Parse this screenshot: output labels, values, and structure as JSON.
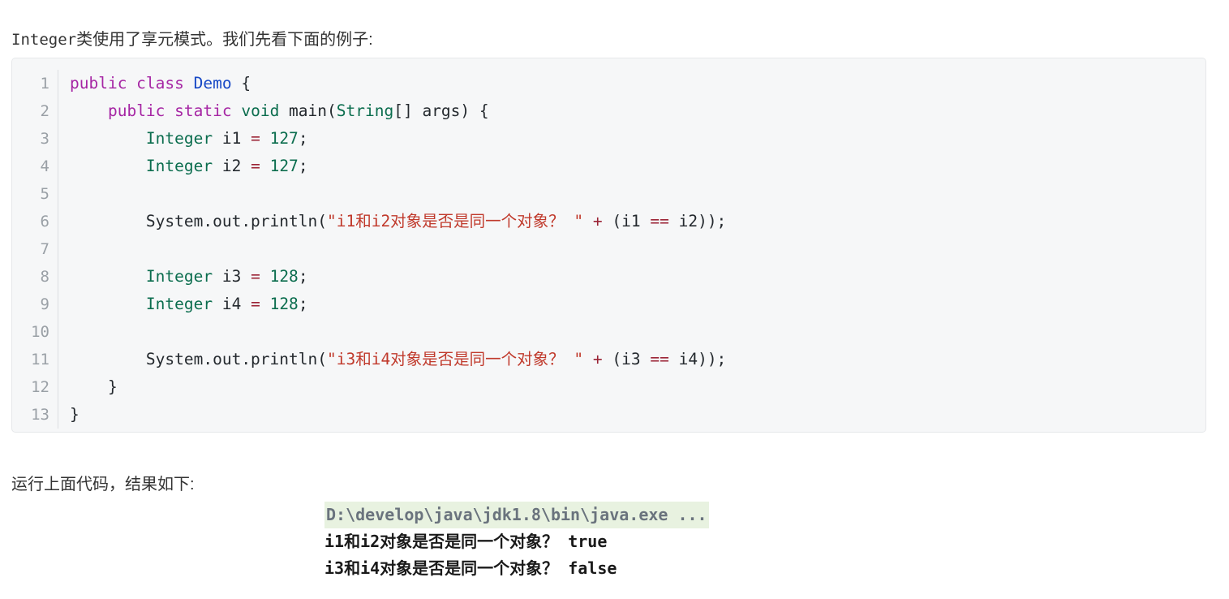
{
  "intro": {
    "mono_prefix": "Integer",
    "text": "类使用了享元模式。我们先看下面的例子:"
  },
  "code_block": {
    "language": "java",
    "theme": {
      "background": "#f6f7f8",
      "border": "#e6e8ea",
      "line_number": "#9aa0a6",
      "keyword": "#a626a4",
      "type": "#0b6d4e",
      "class": "#1849c6",
      "number": "#0b6d4e",
      "string": "#c0392b",
      "operator": "#9b2335",
      "plain": "#24292e"
    },
    "lines": [
      {
        "n": "1",
        "tokens": [
          {
            "t": "public class ",
            "c": "kw"
          },
          {
            "t": "Demo",
            "c": "cls"
          },
          {
            "t": " {",
            "c": "pln"
          }
        ]
      },
      {
        "n": "2",
        "tokens": [
          {
            "t": "    ",
            "c": "pln"
          },
          {
            "t": "public static ",
            "c": "kw"
          },
          {
            "t": "void",
            "c": "type"
          },
          {
            "t": " main(",
            "c": "pln"
          },
          {
            "t": "String",
            "c": "type"
          },
          {
            "t": "[] args) {",
            "c": "pln"
          }
        ]
      },
      {
        "n": "3",
        "tokens": [
          {
            "t": "        ",
            "c": "pln"
          },
          {
            "t": "Integer",
            "c": "type"
          },
          {
            "t": " i1 ",
            "c": "pln"
          },
          {
            "t": "=",
            "c": "op"
          },
          {
            "t": " ",
            "c": "pln"
          },
          {
            "t": "127",
            "c": "num"
          },
          {
            "t": ";",
            "c": "pln"
          }
        ]
      },
      {
        "n": "4",
        "tokens": [
          {
            "t": "        ",
            "c": "pln"
          },
          {
            "t": "Integer",
            "c": "type"
          },
          {
            "t": " i2 ",
            "c": "pln"
          },
          {
            "t": "=",
            "c": "op"
          },
          {
            "t": " ",
            "c": "pln"
          },
          {
            "t": "127",
            "c": "num"
          },
          {
            "t": ";",
            "c": "pln"
          }
        ]
      },
      {
        "n": "5",
        "tokens": []
      },
      {
        "n": "6",
        "tokens": [
          {
            "t": "        ",
            "c": "pln"
          },
          {
            "t": "System.out.println(",
            "c": "pln"
          },
          {
            "t": "\"i1和i2对象是否是同一个对象？ \"",
            "c": "str"
          },
          {
            "t": " ",
            "c": "pln"
          },
          {
            "t": "+",
            "c": "op"
          },
          {
            "t": " (i1 ",
            "c": "pln"
          },
          {
            "t": "==",
            "c": "op"
          },
          {
            "t": " i2));",
            "c": "pln"
          }
        ]
      },
      {
        "n": "7",
        "tokens": []
      },
      {
        "n": "8",
        "tokens": [
          {
            "t": "        ",
            "c": "pln"
          },
          {
            "t": "Integer",
            "c": "type"
          },
          {
            "t": " i3 ",
            "c": "pln"
          },
          {
            "t": "=",
            "c": "op"
          },
          {
            "t": " ",
            "c": "pln"
          },
          {
            "t": "128",
            "c": "num"
          },
          {
            "t": ";",
            "c": "pln"
          }
        ]
      },
      {
        "n": "9",
        "tokens": [
          {
            "t": "        ",
            "c": "pln"
          },
          {
            "t": "Integer",
            "c": "type"
          },
          {
            "t": " i4 ",
            "c": "pln"
          },
          {
            "t": "=",
            "c": "op"
          },
          {
            "t": " ",
            "c": "pln"
          },
          {
            "t": "128",
            "c": "num"
          },
          {
            "t": ";",
            "c": "pln"
          }
        ]
      },
      {
        "n": "10",
        "tokens": []
      },
      {
        "n": "11",
        "tokens": [
          {
            "t": "        ",
            "c": "pln"
          },
          {
            "t": "System.out.println(",
            "c": "pln"
          },
          {
            "t": "\"i3和i4对象是否是同一个对象？ \"",
            "c": "str"
          },
          {
            "t": " ",
            "c": "pln"
          },
          {
            "t": "+",
            "c": "op"
          },
          {
            "t": " (i3 ",
            "c": "pln"
          },
          {
            "t": "==",
            "c": "op"
          },
          {
            "t": " i4));",
            "c": "pln"
          }
        ]
      },
      {
        "n": "12",
        "tokens": [
          {
            "t": "    }",
            "c": "pln"
          }
        ]
      },
      {
        "n": "13",
        "tokens": [
          {
            "t": "}",
            "c": "pln"
          }
        ]
      }
    ]
  },
  "run_para": {
    "text": "运行上面代码，结果如下:"
  },
  "console": {
    "highlight_color": "#e8f2e0",
    "command_color": "#6a737d",
    "lines": [
      {
        "text": "D:\\develop\\java\\jdk1.8\\bin\\java.exe ...",
        "style": "cmd"
      },
      {
        "text": "i1和i2对象是否是同一个对象？ true",
        "style": "out"
      },
      {
        "text": "i3和i4对象是否是同一个对象？ false",
        "style": "out"
      }
    ]
  }
}
